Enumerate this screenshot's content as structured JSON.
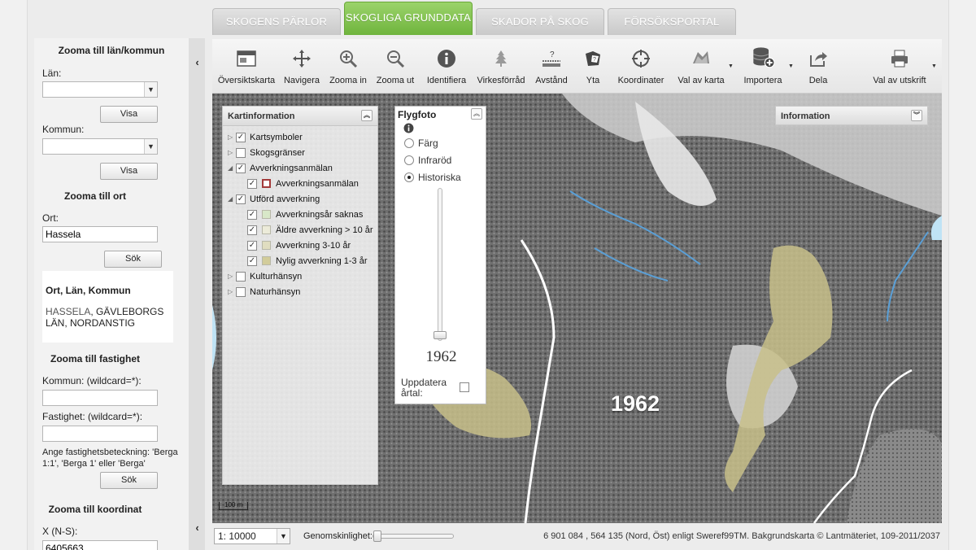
{
  "tabs": [
    {
      "label": "SKOGENS PÄRLOR",
      "active": false
    },
    {
      "label": "SKOGLIGA GRUNDDATA",
      "active": true
    },
    {
      "label": "SKADOR PÅ SKOG",
      "active": false
    },
    {
      "label": "FÖRSÖKSPORTAL",
      "active": false
    }
  ],
  "left": {
    "lan_kommun": {
      "title": "Zooma till län/kommun",
      "lan_label": "Län:",
      "kommun_label": "Kommun:",
      "show_button": "Visa"
    },
    "ort": {
      "title": "Zooma till ort",
      "ort_label": "Ort:",
      "ort_value": "Hassela",
      "search_button": "Sök"
    },
    "result": {
      "heading": "Ort, Län, Kommun",
      "place": "HASSELA",
      "rest": ", GÄVLEBORGS LÄN, NORDANSTIG"
    },
    "fastighet": {
      "title": "Zooma till fastighet",
      "kommun_label": "Kommun: (wildcard=*):",
      "fastighet_label": "Fastighet: (wildcard=*):",
      "hint": "Ange fastighetsbeteckning: 'Berga 1:1', 'Berga 1' eller 'Berga'",
      "search_button": "Sök"
    },
    "koordinat": {
      "title": "Zooma till koordinat",
      "x_label": "X (N-S):",
      "x_value": "6405663"
    },
    "collapse_glyph": "‹"
  },
  "toolbar": [
    {
      "label": "Översiktskarta",
      "icon": "overview-map-icon"
    },
    {
      "label": "Navigera",
      "icon": "navigate-icon"
    },
    {
      "label": "Zooma in",
      "icon": "zoom-in-icon"
    },
    {
      "label": "Zooma ut",
      "icon": "zoom-out-icon"
    },
    {
      "label": "Identifiera",
      "icon": "info-icon"
    },
    {
      "label": "Virkesförråd",
      "icon": "tree-icon"
    },
    {
      "label": "Avstånd",
      "icon": "distance-icon"
    },
    {
      "label": "Yta",
      "icon": "area-icon"
    },
    {
      "label": "Koordinater",
      "icon": "crosshair-icon"
    },
    {
      "label": "Val av karta",
      "icon": "map-select-icon"
    },
    {
      "label": "Importera",
      "icon": "database-import-icon"
    },
    {
      "label": "Dela",
      "icon": "share-icon"
    },
    {
      "label": "Val av utskrift",
      "icon": "printer-icon"
    }
  ],
  "kartinfo": {
    "title": "Kartinformation",
    "items": [
      {
        "label": "Kartsymboler",
        "checked": true,
        "level": 0,
        "expanded": false
      },
      {
        "label": "Skogsgränser",
        "checked": false,
        "level": 0,
        "expanded": false
      },
      {
        "label": "Avverkningsanmälan",
        "checked": true,
        "level": 0,
        "expanded": true
      },
      {
        "label": "Avverkningsanmälan",
        "checked": true,
        "level": 1,
        "symbol": "#a33a3a"
      },
      {
        "label": "Utförd avverkning",
        "checked": true,
        "level": 0,
        "expanded": true
      },
      {
        "label": "Avverkningsår saknas",
        "checked": true,
        "level": 1,
        "symbol": "#d8e8c8"
      },
      {
        "label": "Äldre avverkning > 10 år",
        "checked": true,
        "level": 1,
        "symbol": "#ecebd9"
      },
      {
        "label": "Avverkning 3-10 år",
        "checked": true,
        "level": 1,
        "symbol": "#e0ddc0"
      },
      {
        "label": "Nylig avverkning 1-3 år",
        "checked": true,
        "level": 1,
        "symbol": "#d2cc9a"
      },
      {
        "label": "Kulturhänsyn",
        "checked": false,
        "level": 0,
        "expanded": false
      },
      {
        "label": "Naturhänsyn",
        "checked": false,
        "level": 0,
        "expanded": false
      }
    ]
  },
  "flygfoto": {
    "title": "Flygfoto",
    "options": [
      {
        "label": "Färg",
        "selected": false
      },
      {
        "label": "Infraröd",
        "selected": false
      },
      {
        "label": "Historiska",
        "selected": true
      }
    ],
    "year": "1962",
    "update_label": "Uppdatera årtal:"
  },
  "information": {
    "title": "Information"
  },
  "map": {
    "year_overlay": "1962",
    "scalebar": "100 m"
  },
  "bottom": {
    "scale": "1: 10000",
    "opacity_label": "Genomskinlighet:",
    "coords": "6 901 084 , 564 135 (Nord, Öst) enligt Sweref99TM. Bakgrundskarta © Lantmäteriet, 109-2011/2037"
  },
  "colors": {
    "active_tab": "#7cc044",
    "clearcut": "#c8c08a",
    "water": "#5a9fd6"
  }
}
